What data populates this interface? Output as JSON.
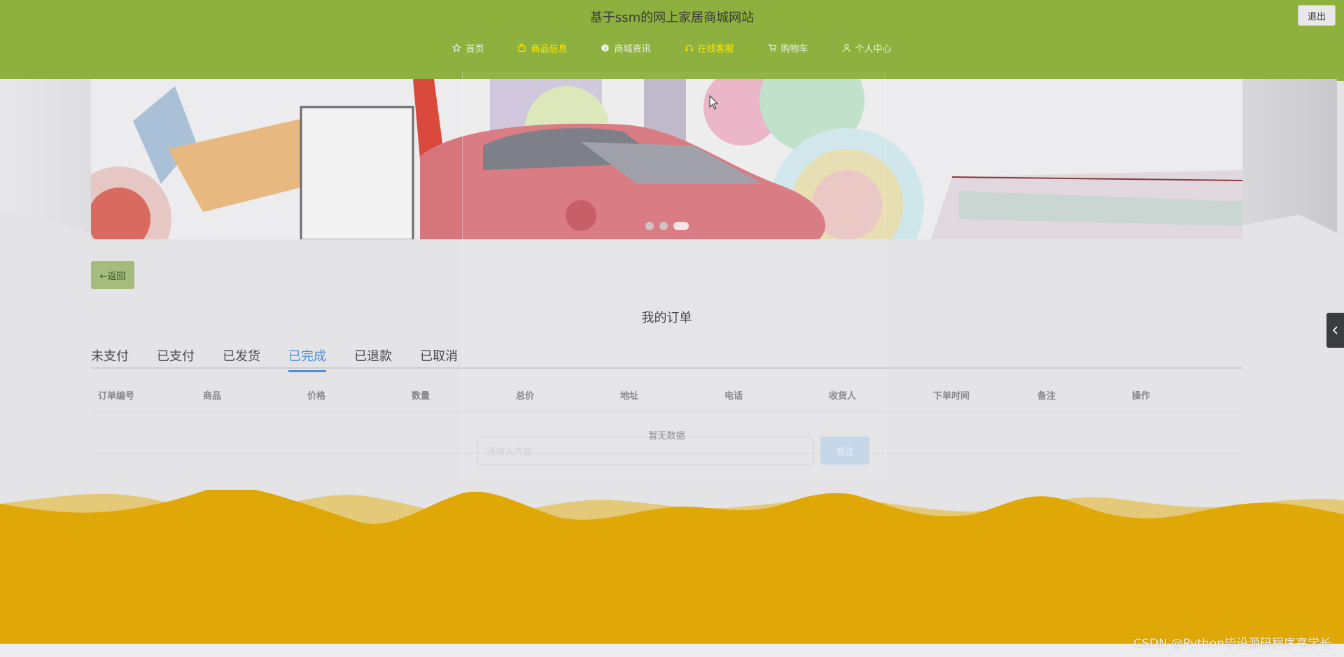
{
  "header": {
    "site_title": "基于ssm的网上家居商城网站",
    "logout_label": "退出",
    "nav": [
      {
        "label": "首页",
        "icon": "star-icon",
        "active": false
      },
      {
        "label": "商品信息",
        "icon": "bag-icon",
        "active": true
      },
      {
        "label": "商城资讯",
        "icon": "info-icon",
        "active": false
      },
      {
        "label": "在线客服",
        "icon": "headset-icon",
        "active": true
      },
      {
        "label": "购物车",
        "icon": "cart-icon",
        "active": false
      },
      {
        "label": "个人中心",
        "icon": "user-icon",
        "active": false
      }
    ]
  },
  "banner": {
    "slides_total": 3,
    "active_slide": 3
  },
  "modal_ghost": {
    "input_placeholder": "请输入内容",
    "button_label": "发送"
  },
  "page": {
    "back_label": "←返回",
    "title": "我的订单"
  },
  "tabs": [
    {
      "label": "未支付",
      "active": false
    },
    {
      "label": "已支付",
      "active": false
    },
    {
      "label": "已发货",
      "active": false
    },
    {
      "label": "已完成",
      "active": true
    },
    {
      "label": "已退款",
      "active": false
    },
    {
      "label": "已取消",
      "active": false
    }
  ],
  "table": {
    "columns": [
      "订单编号",
      "商品",
      "价格",
      "数量",
      "总价",
      "地址",
      "电话",
      "收货人",
      "下单时间",
      "备注",
      "操作"
    ],
    "empty_text": "暂无数据"
  },
  "watermark": "CSDN @Python毕设源码程序高学长",
  "side_toggle_icon": "chevron-left-icon",
  "colors": {
    "header_green": "#8db03e",
    "active_nav": "#ffe600",
    "active_tab": "#4e8fd8",
    "footer_gold": "#e0a806"
  }
}
